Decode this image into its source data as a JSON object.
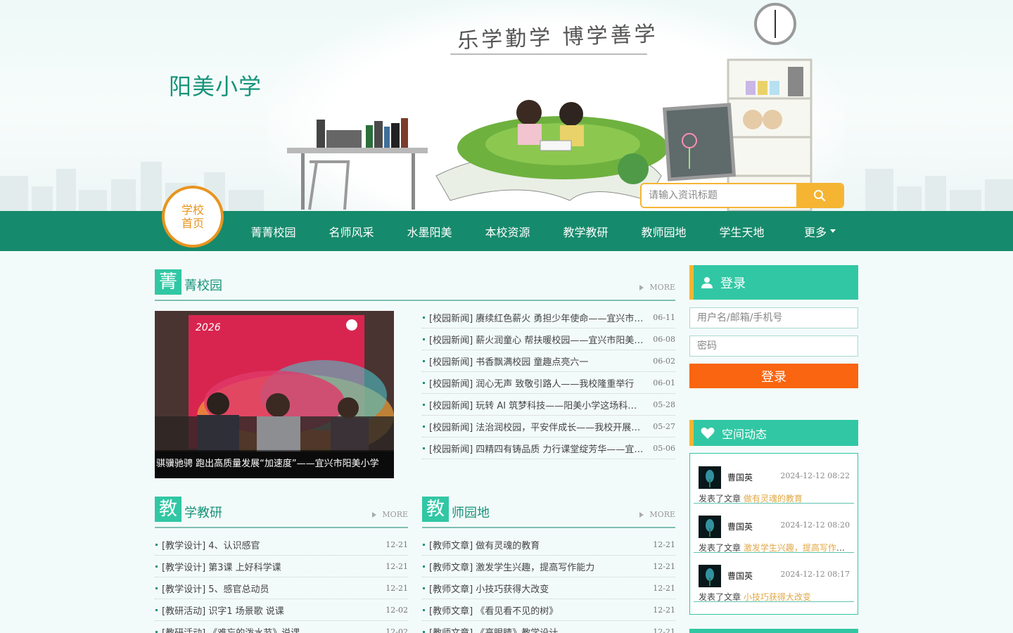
{
  "header": {
    "site_title": "阳美小学",
    "motto": "乐学勤学  博学善学",
    "search_placeholder": "请输入资讯标题"
  },
  "nav": {
    "home_line1": "学校",
    "home_line2": "首页",
    "items": [
      {
        "label": "菁菁校园"
      },
      {
        "label": "名师风采"
      },
      {
        "label": "水墨阳美"
      },
      {
        "label": "本校资源"
      },
      {
        "label": "教学教研"
      },
      {
        "label": "教师园地"
      },
      {
        "label": "学生天地"
      },
      {
        "label": "更多"
      }
    ]
  },
  "campus": {
    "badge": "菁",
    "title": "菁校园",
    "more": "MORE",
    "photo_caption": "骐骥驰骋 跑出高质量发展“加速度”——宜兴市阳美小学",
    "news": [
      {
        "text": "[校园新闻] 赓续红色薪火 勇担少年使命——宜兴市阳美小学",
        "date": "06-11"
      },
      {
        "text": "[校园新闻] 薪火润童心 帮扶暖校园——宜兴市阳美小学",
        "date": "06-08"
      },
      {
        "text": "[校园新闻] 书香飘满校园 童趣点亮六一",
        "date": "06-02"
      },
      {
        "text": "[校园新闻] 润心无声 致敬引路人——我校隆重举行",
        "date": "06-01"
      },
      {
        "text": "[校园新闻] 玩转 AI 筑梦科技——阳美小学这场科技节",
        "date": "05-28"
      },
      {
        "text": "[校园新闻] 法治润校园，平安伴成长——我校开展法治教育",
        "date": "05-27"
      },
      {
        "text": "[校园新闻] 四精四有铸品质 力行课堂绽芳华——宜兴市阳美小学",
        "date": "05-06"
      }
    ]
  },
  "research": {
    "badge": "教",
    "title": "学教研",
    "more": "MORE",
    "news": [
      {
        "text": "[教学设计] 4、认识感官",
        "date": "12-21"
      },
      {
        "text": "[教学设计] 第3课 上好科学课",
        "date": "12-21"
      },
      {
        "text": "[教学设计] 5、感官总动员",
        "date": "12-21"
      },
      {
        "text": "[教研活动] 识字1 场景歌 说课",
        "date": "12-02"
      },
      {
        "text": "[教研活动] 《难忘的泼水节》说课",
        "date": "12-02"
      }
    ]
  },
  "teachers": {
    "badge": "教",
    "title": "师园地",
    "more": "MORE",
    "news": [
      {
        "text": "[教师文章] 做有灵魂的教育",
        "date": "12-21"
      },
      {
        "text": "[教师文章] 激发学生兴趣，提高写作能力",
        "date": "12-21"
      },
      {
        "text": "[教师文章] 小技巧获得大改变",
        "date": "12-21"
      },
      {
        "text": "[教师文章] 《看见看不见的树》",
        "date": "12-21"
      },
      {
        "text": "[教师文章] 《高眼睛》教学设计",
        "date": "12-21"
      }
    ]
  },
  "login": {
    "title": "登录",
    "username_placeholder": "用户名/邮箱/手机号",
    "password_placeholder": "密码",
    "button": "登录"
  },
  "dynamics": {
    "title": "空间动态",
    "items": [
      {
        "name": "曹国英",
        "time": "2024-12-12 08:22",
        "action": "发表了文章",
        "article": "做有灵魂的教育"
      },
      {
        "name": "曹国英",
        "time": "2024-12-12 08:20",
        "action": "发表了文章",
        "article": "激发学生兴趣，提高写作能力"
      },
      {
        "name": "曹国英",
        "time": "2024-12-12 08:17",
        "action": "发表了文章",
        "article": "小技巧获得大改变"
      }
    ]
  },
  "colors": {
    "nav_green": "#168a6c",
    "accent_teal": "#31c7a4",
    "accent_orange": "#f5b533",
    "login_orange": "#f96510"
  }
}
